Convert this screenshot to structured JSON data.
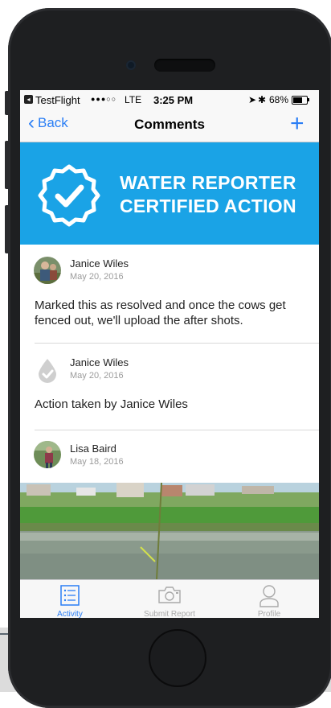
{
  "status_bar": {
    "carrier": "TestFlight",
    "signal": "●●●○○",
    "network": "LTE",
    "time": "3:25 PM",
    "battery": "68%",
    "battery_level": 0.68
  },
  "nav": {
    "back_label": "Back",
    "title": "Comments",
    "add_symbol": "+"
  },
  "banner": {
    "line1": "WATER REPORTER",
    "line2": "CERTIFIED ACTION",
    "badge_icon": "checkmark-badge-icon",
    "color": "#1aa3e6"
  },
  "comments": [
    {
      "author": "Janice Wiles",
      "date": "May 20, 2016",
      "text": "Marked this as resolved and once the cows get fenced out, we'll upload the after shots."
    },
    {
      "author": "Janice Wiles",
      "date": "May 20, 2016",
      "text": "Action taken by Janice Wiles"
    },
    {
      "author": "Lisa Baird",
      "date": "May 18, 2016"
    }
  ],
  "tabs": [
    {
      "label": "Activity",
      "icon": "list-icon",
      "active": true
    },
    {
      "label": "Submit Report",
      "icon": "camera-icon",
      "active": false
    },
    {
      "label": "Profile",
      "icon": "person-icon",
      "active": false
    }
  ],
  "colors": {
    "accent": "#2a7ef5",
    "active_tab": "#2a7ef5",
    "inactive_tab": "#a9a9a9"
  }
}
